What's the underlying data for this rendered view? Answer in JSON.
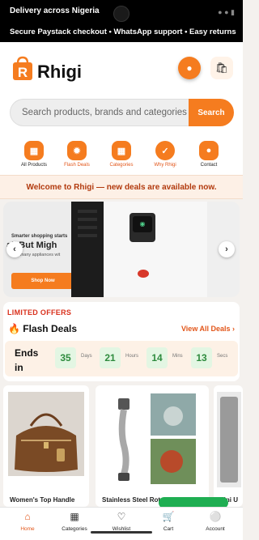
{
  "topbar": {
    "line1": "Delivery across Nigeria",
    "line2": "Secure Paystack checkout • WhatsApp support • Easy returns"
  },
  "header": {
    "brand": "Rhigi",
    "accent_color": "#f57c1f"
  },
  "search": {
    "placeholder": "Search products, brands and categories",
    "button_label": "Search"
  },
  "quicknav": [
    {
      "label": "All Products",
      "icon": "grid-icon"
    },
    {
      "label": "Flash Deals",
      "icon": "lightning-icon"
    },
    {
      "label": "Categories",
      "icon": "categories-icon"
    },
    {
      "label": "Why Rhigi",
      "icon": "check-icon"
    },
    {
      "label": "Contact",
      "icon": "contact-icon"
    }
  ],
  "welcome": "Welcome to Rhigi — new deals are available now.",
  "carousel": {
    "small_text": "Smarter shopping starts",
    "big_text": "all But Migh",
    "sub_text": "ters many appliances wit",
    "button_label": "Shop Now",
    "prev": "‹",
    "next": "›"
  },
  "deals": {
    "eyebrow": "LIMITED OFFERS",
    "title": "Flash Deals",
    "view_all": "View All Deals ›",
    "ends_label": "Ends in",
    "countdown": [
      {
        "value": "35",
        "unit": "Days"
      },
      {
        "value": "21",
        "unit": "Hours"
      },
      {
        "value": "14",
        "unit": "Mins"
      },
      {
        "value": "13",
        "unit": "Secs"
      }
    ]
  },
  "products": [
    {
      "name": "Women's Top Handle"
    },
    {
      "name": "Stainless Steel Rotati"
    },
    {
      "name": "Mini U"
    }
  ],
  "bottomnav": [
    {
      "label": "Home",
      "icon": "home-icon",
      "active": true
    },
    {
      "label": "Categories",
      "icon": "grid-icon"
    },
    {
      "label": "Wishlist",
      "icon": "heart-icon"
    },
    {
      "label": "Cart",
      "icon": "cart-icon"
    },
    {
      "label": "Account",
      "icon": "account-icon"
    }
  ]
}
